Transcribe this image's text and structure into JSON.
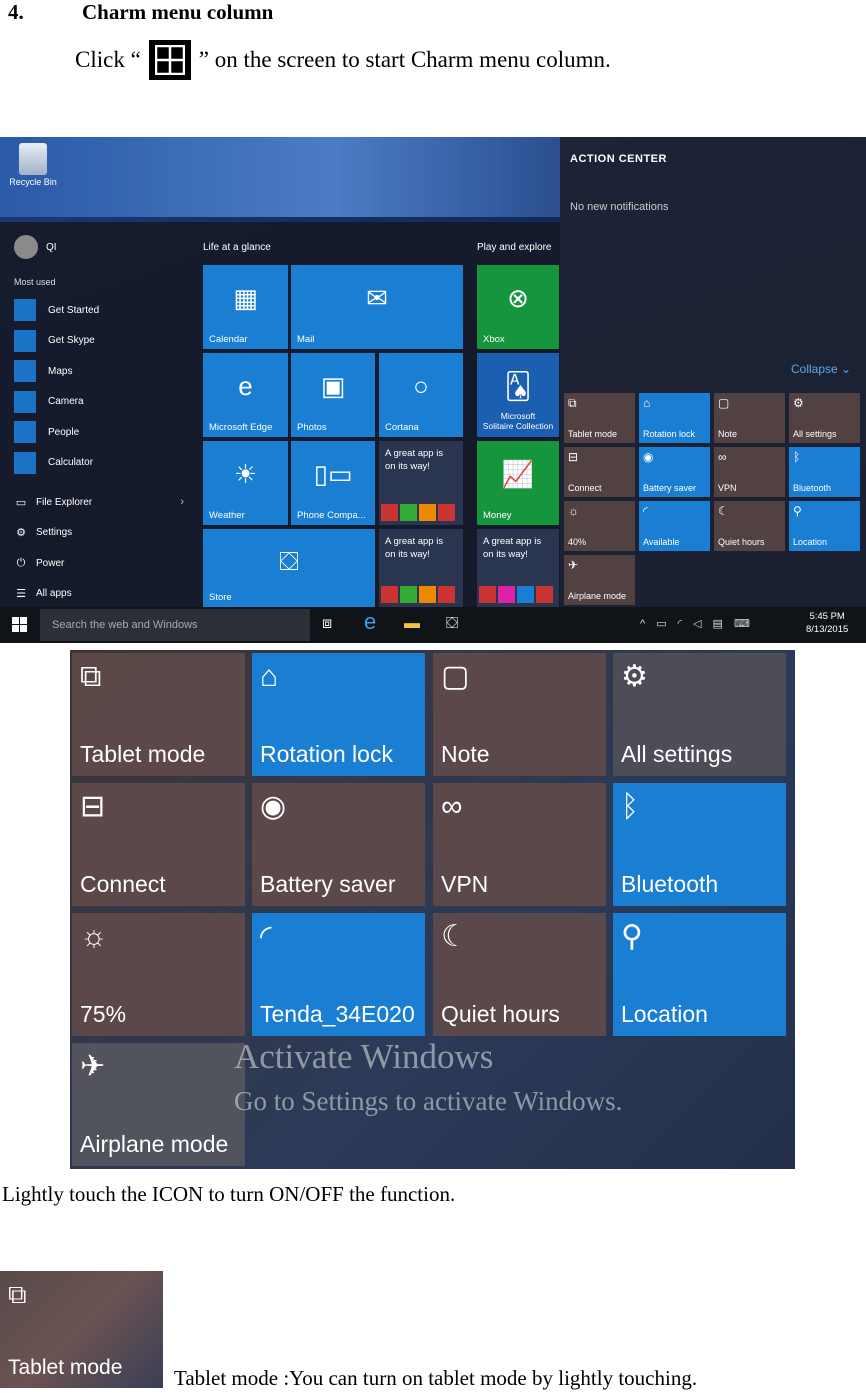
{
  "section": {
    "number": "4.",
    "title": "Charm menu column"
  },
  "instruction": {
    "before": "Click “",
    "after": "” on the screen to start Charm menu column.",
    "icon": "windows-logo-icon"
  },
  "screenshot": {
    "desktop": {
      "recycle_bin": "Recycle Bin"
    },
    "start_menu": {
      "user": "QI",
      "most_used_label": "Most used",
      "apps": [
        "Get Started",
        "Get Skype",
        "Maps",
        "Camera",
        "People",
        "Calculator"
      ],
      "system": [
        "File Explorer",
        "Settings",
        "Power",
        "All apps"
      ],
      "groups": [
        "Life at a glance",
        "Play and explore"
      ],
      "tiles": {
        "calendar": "Calendar",
        "mail": "Mail",
        "edge": "Microsoft Edge",
        "photos": "Photos",
        "cortana": "Cortana",
        "weather": "Weather",
        "phone": "Phone Compa...",
        "store": "Store",
        "xbox": "Xbox",
        "solitaire_1": "Microsoft",
        "solitaire_2": "Solitaire Collection",
        "money": "Money",
        "great_app_1": "A great app is",
        "great_app_2": "on its way!"
      }
    },
    "action_center": {
      "title": "ACTION CENTER",
      "no_notifications": "No new notifications",
      "collapse": "Collapse",
      "quick_actions": [
        "Tablet mode",
        "Rotation lock",
        "Note",
        "All settings",
        "Connect",
        "Battery saver",
        "VPN",
        "Bluetooth",
        "40%",
        "Available",
        "Quiet hours",
        "Location",
        "Airplane mode"
      ]
    },
    "taskbar": {
      "search_placeholder": "Search the web and Windows",
      "time": "5:45 PM",
      "date": "8/13/2015"
    }
  },
  "zoom_panel": {
    "tiles": [
      "Tablet mode",
      "Rotation lock",
      "Note",
      "All settings",
      "Connect",
      "Battery saver",
      "VPN",
      "Bluetooth",
      "75%",
      "Tenda_34E020",
      "Quiet hours",
      "Location",
      "Airplane mode"
    ],
    "watermark_1": "Activate Windows",
    "watermark_2": "Go to Settings to activate Windows."
  },
  "caption": "Lightly touch the ICON to turn ON/OFF the function.",
  "tablet_tile_label": "Tablet mode",
  "tablet_desc": "Tablet mode :You can turn on tablet mode by lightly touching.",
  "colors": {
    "tile_blue": "#1a7fd2",
    "tile_green": "#15963c",
    "tile_off": "#604a4a"
  }
}
